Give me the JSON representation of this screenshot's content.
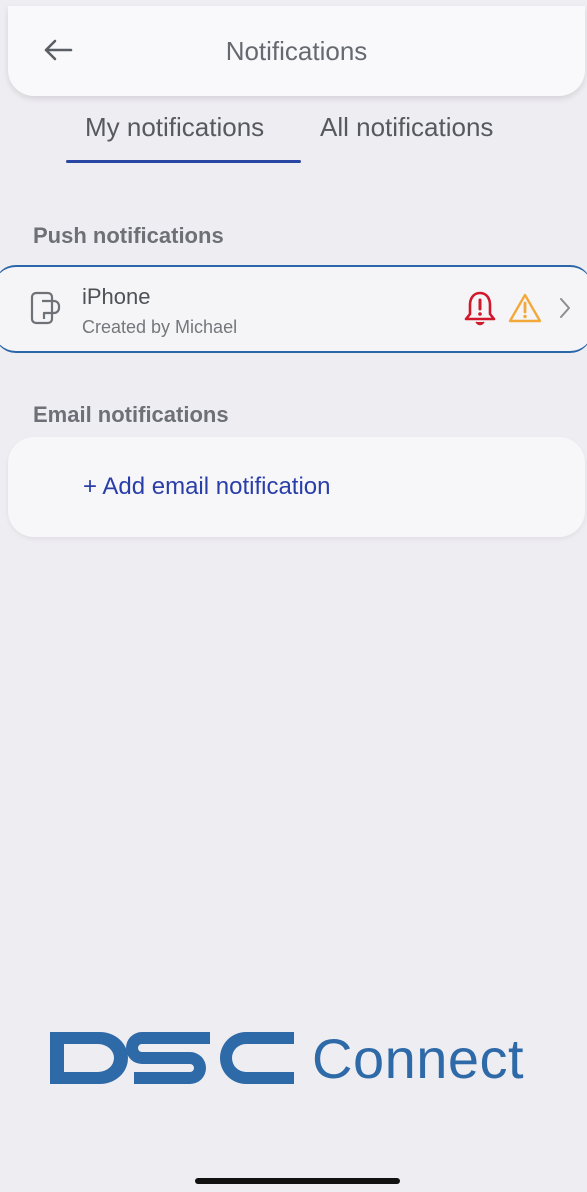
{
  "header": {
    "title": "Notifications",
    "back_icon": "arrow-left-icon"
  },
  "tabs": [
    {
      "label": "My notifications",
      "selected": true
    },
    {
      "label": "All notifications",
      "selected": false
    }
  ],
  "push_section": {
    "label": "Push notifications",
    "devices": [
      {
        "name": "iPhone",
        "subtitle": "Created by Michael",
        "icon": "phone-device-icon",
        "status_icons": [
          "alarm-bell-icon",
          "warning-triangle-icon"
        ]
      }
    ]
  },
  "email_section": {
    "label": "Email notifications",
    "add_label": "+ Add email notification"
  },
  "brand": {
    "logo_mark": "DSC",
    "logo_text": "Connect",
    "color": "#2f6aa8"
  },
  "colors": {
    "accent": "#2a46a3",
    "alarm": "#d0192b",
    "warning": "#f3a83a"
  }
}
